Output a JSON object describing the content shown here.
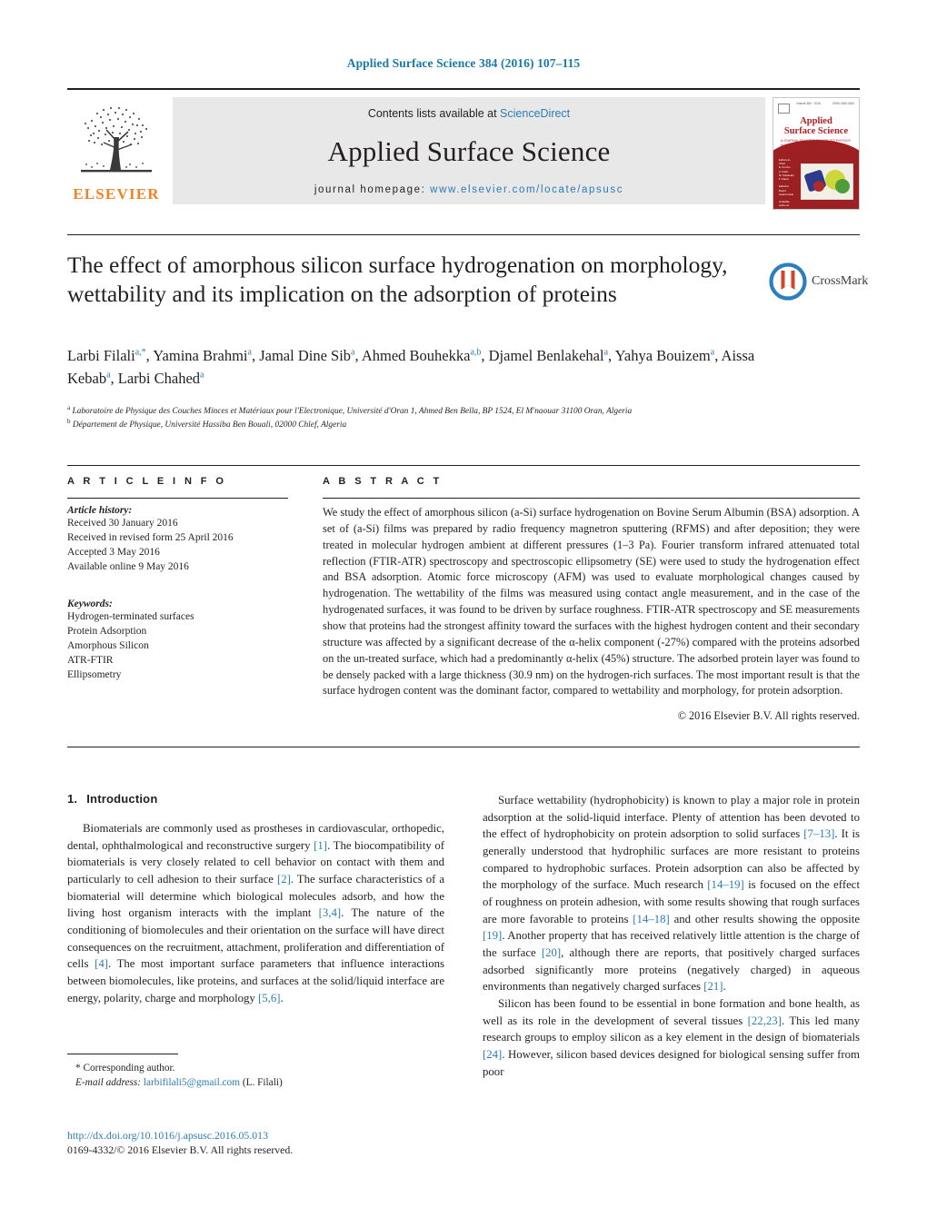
{
  "running_head": "Applied Surface Science 384 (2016) 107–115",
  "masthead": {
    "publisher": "ELSEVIER",
    "contents_prefix": "Contents lists available at ",
    "contents_link": "ScienceDirect",
    "journal_name": "Applied Surface Science",
    "homepage_prefix": "journal homepage: ",
    "homepage_url": "www.elsevier.com/locate/apsusc",
    "cover": {
      "title_line1": "Applied",
      "title_line2": "Surface Science",
      "subtitle": "A JOURNAL DEVOTED TO APPLIED PHYSICS AND CHEMISTRY OF SURFACES AND INTERFACES",
      "topbar_text": "Volume 384 · 2016",
      "topbar_right": "ISSN 0169-4332",
      "sidecol": "Editors-in-Chief\nE. Fromm\nA. Kahn\nM. Kawasaki\nF. Zaera\n\nEditorial Board\nListed inside\n\nAvailable online at\nScienceDirect"
    }
  },
  "crossmark": {
    "label": "CrossMark"
  },
  "title": "The effect of amorphous silicon surface hydrogenation on morphology, wettability and its implication on the adsorption of proteins",
  "authors_html": "Larbi Filali<sup>a,<span class=\"star\">*</span></sup>, Yamina Brahmi<sup>a</sup>, Jamal Dine Sib<sup>a</sup>, Ahmed Bouhekka<sup>a,b</sup>, Djamel Benlakehal<sup>a</sup>, Yahya Bouizem<sup>a</sup>, Aissa Kebab<sup>a</sup>, Larbi Chahed<sup>a</sup>",
  "affiliations": [
    {
      "marker": "a",
      "text": "Laboratoire de Physique des Couches Minces et Matériaux pour l'Electronique, Université d'Oran 1, Ahmed Ben Bella, BP 1524, El M'naouar 31100 Oran, Algeria"
    },
    {
      "marker": "b",
      "text": "Département de Physique, Université Hassiba Ben Bouali, 02000 Chlef, Algeria"
    }
  ],
  "headings": {
    "article_info": "A R T I C L E   I N F O",
    "abstract": "A B S T R A C T"
  },
  "article_history": {
    "label": "Article history:",
    "lines": [
      "Received 30 January 2016",
      "Received in revised form 25 April 2016",
      "Accepted 3 May 2016",
      "Available online 9 May 2016"
    ]
  },
  "keywords": {
    "label": "Keywords:",
    "items": [
      "Hydrogen-terminated surfaces",
      "Protein Adsorption",
      "Amorphous Silicon",
      "ATR-FTIR",
      "Ellipsometry"
    ]
  },
  "abstract": {
    "text": "We study the effect of amorphous silicon (a-Si) surface hydrogenation on Bovine Serum Albumin (BSA) adsorption. A set of (a-Si) films was prepared by radio frequency magnetron sputtering (RFMS) and after deposition; they were treated in molecular hydrogen ambient at different pressures (1–3 Pa). Fourier transform infrared attenuated total reflection (FTIR-ATR) spectroscopy and spectroscopic ellipsometry (SE) were used to study the hydrogenation effect and BSA adsorption. Atomic force microscopy (AFM) was used to evaluate morphological changes caused by hydrogenation. The wettability of the films was measured using contact angle measurement, and in the case of the hydrogenated surfaces, it was found to be driven by surface roughness. FTIR-ATR spectroscopy and SE measurements show that proteins had the strongest affinity toward the surfaces with the highest hydrogen content and their secondary structure was affected by a significant decrease of the α-helix component (-27%) compared with the proteins adsorbed on the un-treated surface, which had a predominantly α-helix (45%) structure. The adsorbed protein layer was found to be densely packed with a large thickness (30.9 nm) on the hydrogen-rich surfaces. The most important result is that the surface hydrogen content was the dominant factor, compared to wettability and morphology, for protein adsorption.",
    "copyright": "© 2016 Elsevier B.V. All rights reserved."
  },
  "introduction": {
    "number": "1.",
    "title": "Introduction",
    "left_paragraphs_html": [
      "Biomaterials are commonly used as prostheses in cardiovascular, orthopedic, dental, ophthalmological and reconstructive surgery <span class=\"ref\">[1]</span>. The biocompatibility of biomaterials is very closely related to cell behavior on contact with them and particularly to cell adhesion to their surface <span class=\"ref\">[2]</span>. The surface characteristics of a biomaterial will determine which biological molecules adsorb, and how the living host organism interacts with the implant <span class=\"ref\">[3,4]</span>. The nature of the conditioning of biomolecules and their orientation on the surface will have direct consequences on the recruitment, attachment, proliferation and differentiation of cells <span class=\"ref\">[4]</span>. The most important surface parameters that influence interactions between biomolecules, like proteins, and surfaces at the solid/liquid interface are energy, polarity, charge and morphology <span class=\"ref\">[5,6]</span>."
    ],
    "right_paragraphs_html": [
      "Surface wettability (hydrophobicity) is known to play a major role in protein adsorption at the solid-liquid interface. Plenty of attention has been devoted to the effect of hydrophobicity on protein adsorption to solid surfaces <span class=\"ref\">[7–13]</span>. It is generally understood that hydrophilic surfaces are more resistant to proteins compared to hydrophobic surfaces. Protein adsorption can also be affected by the morphology of the surface. Much research <span class=\"ref\">[14–19]</span> is focused on the effect of roughness on protein adhesion, with some results showing that rough surfaces are more favorable to proteins <span class=\"ref\">[14–18]</span> and other results showing the opposite <span class=\"ref\">[19]</span>. Another property that has received relatively little attention is the charge of the surface <span class=\"ref\">[20]</span>, although there are reports, that positively charged surfaces adsorbed significantly more proteins (negatively charged) in aqueous environments than negatively charged surfaces <span class=\"ref\">[21]</span>.",
      "Silicon has been found to be essential in bone formation and bone health, as well as its role in the development of several tissues <span class=\"ref\">[22,23]</span>. This led many research groups to employ silicon as a key element in the design of biomaterials <span class=\"ref\">[24]</span>. However, silicon based devices designed for biological sensing suffer from poor"
    ]
  },
  "footnote": {
    "corresponding": "* Corresponding author.",
    "email_label": "E-mail address:",
    "email": "larbifilali5@gmail.com",
    "email_suffix": "(L. Filali)"
  },
  "doi": {
    "url": "http://dx.doi.org/10.1016/j.apsusc.2016.05.013",
    "issn_line": "0169-4332/© 2016 Elsevier B.V. All rights reserved."
  },
  "colors": {
    "link_blue": "#2c7bb6",
    "running_head_blue": "#1a7aa8",
    "elsevier_orange": "#f58220",
    "band_gray": "#e8e8e8",
    "cover_red": "#9c1f22"
  }
}
